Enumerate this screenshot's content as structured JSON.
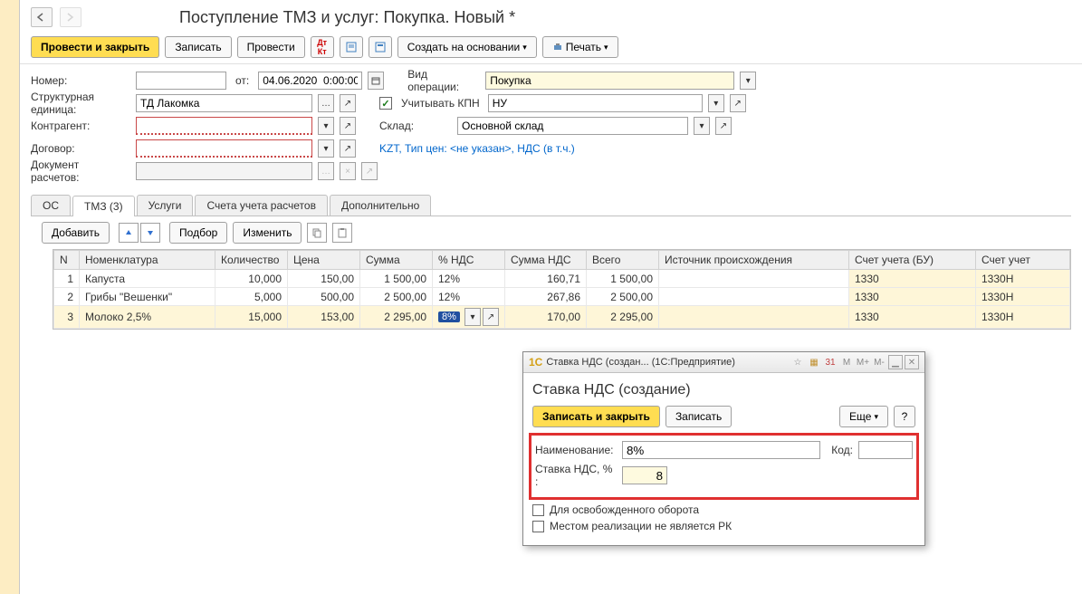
{
  "nav": {
    "title": "Поступление ТМЗ и услуг: Покупка. Новый *"
  },
  "toolbar": {
    "post_close": "Провести и закрыть",
    "write": "Записать",
    "post": "Провести",
    "create_based": "Создать на основании",
    "print": "Печать"
  },
  "form": {
    "number_label": "Номер:",
    "from_label": "от:",
    "date": "04.06.2020  0:00:00",
    "operation_label": "Вид операции:",
    "operation": "Покупка",
    "org_label": "Структурная единица:",
    "org": "ТД Лакомка",
    "kpn_label": "Учитывать КПН",
    "kpn_val": "НУ",
    "counterparty_label": "Контрагент:",
    "warehouse_label": "Склад:",
    "warehouse": "Основной склад",
    "contract_label": "Договор:",
    "price_info": "KZT, Тип цен: <не указан>, НДС (в т.ч.)",
    "settlement_doc_label": "Документ расчетов:"
  },
  "tabs": {
    "os": "ОС",
    "tmz": "ТМЗ (3)",
    "services": "Услуги",
    "accounts": "Счета учета расчетов",
    "additional": "Дополнительно"
  },
  "table_toolbar": {
    "add": "Добавить",
    "pick": "Подбор",
    "change": "Изменить"
  },
  "columns": {
    "n": "N",
    "nomen": "Номенклатура",
    "qty": "Количество",
    "price": "Цена",
    "sum": "Сумма",
    "vat_pct": "% НДС",
    "vat_sum": "Сумма НДС",
    "total": "Всего",
    "origin": "Источник происхождения",
    "acct_bu": "Счет учета (БУ)",
    "acct_nu": "Счет учет"
  },
  "rows": [
    {
      "n": "1",
      "nomen": "Капуста",
      "qty": "10,000",
      "price": "150,00",
      "sum": "1 500,00",
      "vat_pct": "12%",
      "vat_sum": "160,71",
      "total": "1 500,00",
      "origin": "",
      "acct_bu": "1330",
      "acct_nu": "1330Н"
    },
    {
      "n": "2",
      "nomen": "Грибы \"Вешенки\"",
      "qty": "5,000",
      "price": "500,00",
      "sum": "2 500,00",
      "vat_pct": "12%",
      "vat_sum": "267,86",
      "total": "2 500,00",
      "origin": "",
      "acct_bu": "1330",
      "acct_nu": "1330Н"
    },
    {
      "n": "3",
      "nomen": "Молоко 2,5%",
      "qty": "15,000",
      "price": "153,00",
      "sum": "2 295,00",
      "vat_pct": "8%",
      "vat_sum": "170,00",
      "total": "2 295,00",
      "origin": "",
      "acct_bu": "1330",
      "acct_nu": "1330Н"
    }
  ],
  "modal": {
    "window_title": "Ставка НДС (создан...   (1С:Предприятие)",
    "heading": "Ставка НДС (создание)",
    "write_close": "Записать и закрыть",
    "write": "Записать",
    "more": "Еще",
    "help": "?",
    "name_label": "Наименование:",
    "name_val": "8%",
    "code_label": "Код:",
    "rate_label": "Ставка НДС, % :",
    "rate_val": "8",
    "exempt": "Для освобожденного оборота",
    "not_rk": "Местом реализации не является РК"
  }
}
